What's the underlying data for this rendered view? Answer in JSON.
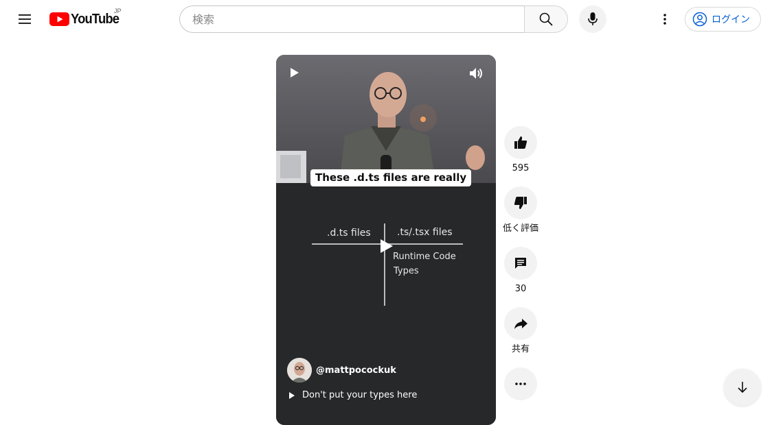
{
  "header": {
    "logo_text": "YouTube",
    "country_code": "JP",
    "search_placeholder": "検索",
    "login_label": "ログイン"
  },
  "video": {
    "caption": "These .d.ts files are really",
    "whiteboard": {
      "left_header": ".d.ts files",
      "right_header": ".ts/.tsx files",
      "right_items": [
        "Runtime Code",
        "Types"
      ]
    },
    "channel_handle": "@mattpocockuk",
    "title": "Don't put your types here"
  },
  "actions": {
    "like_count": "595",
    "dislike_label": "低く評価",
    "comment_count": "30",
    "share_label": "共有"
  },
  "colors": {
    "brand_red": "#ff0000",
    "link_blue": "#065fd4",
    "button_gray": "#f2f2f2"
  }
}
